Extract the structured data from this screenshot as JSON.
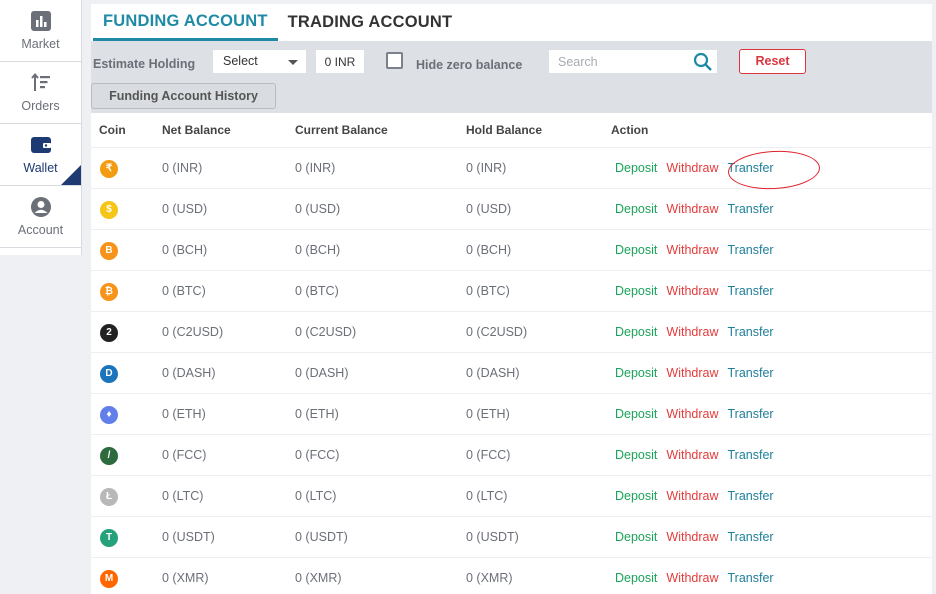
{
  "sidebar": {
    "items": [
      {
        "label": "Market",
        "icon": "chart-icon"
      },
      {
        "label": "Orders",
        "icon": "sort-icon"
      },
      {
        "label": "Wallet",
        "icon": "wallet-icon"
      },
      {
        "label": "Account",
        "icon": "user-icon"
      }
    ],
    "active": "Wallet"
  },
  "tabs": {
    "funding": "FUNDING ACCOUNT",
    "trading": "TRADING ACCOUNT"
  },
  "toolbar": {
    "estimate_label": "Estimate Holding",
    "select_value": "Select",
    "inr_value": "0 INR",
    "hide_zero_label": "Hide zero balance",
    "search_placeholder": "Search",
    "reset_label": "Reset",
    "history_label": "Funding Account History"
  },
  "table": {
    "headers": {
      "coin": "Coin",
      "net": "Net Balance",
      "current": "Current Balance",
      "hold": "Hold Balance",
      "action": "Action"
    },
    "actions": {
      "deposit": "Deposit",
      "withdraw": "Withdraw",
      "transfer": "Transfer"
    },
    "rows": [
      {
        "coin": "INR",
        "net": "0 (INR)",
        "current": "0 (INR)",
        "hold": "0 (INR)",
        "color": "#f39c12",
        "glyph": "₹"
      },
      {
        "coin": "USD",
        "net": "0 (USD)",
        "current": "0 (USD)",
        "hold": "0 (USD)",
        "color": "#f5c518",
        "glyph": "$"
      },
      {
        "coin": "BCH",
        "net": "0 (BCH)",
        "current": "0 (BCH)",
        "hold": "0 (BCH)",
        "color": "#f7931a",
        "glyph": "B"
      },
      {
        "coin": "BTC",
        "net": "0 (BTC)",
        "current": "0 (BTC)",
        "hold": "0 (BTC)",
        "color": "#f7931a",
        "glyph": "₿"
      },
      {
        "coin": "C2USD",
        "net": "0 (C2USD)",
        "current": "0 (C2USD)",
        "hold": "0 (C2USD)",
        "color": "#222222",
        "glyph": "2"
      },
      {
        "coin": "DASH",
        "net": "0 (DASH)",
        "current": "0 (DASH)",
        "hold": "0 (DASH)",
        "color": "#1c75bc",
        "glyph": "D"
      },
      {
        "coin": "ETH",
        "net": "0 (ETH)",
        "current": "0 (ETH)",
        "hold": "0 (ETH)",
        "color": "#627eea",
        "glyph": "♦"
      },
      {
        "coin": "FCC",
        "net": "0 (FCC)",
        "current": "0 (FCC)",
        "hold": "0 (FCC)",
        "color": "#2d6a3e",
        "glyph": "/"
      },
      {
        "coin": "LTC",
        "net": "0 (LTC)",
        "current": "0 (LTC)",
        "hold": "0 (LTC)",
        "color": "#b8b8b8",
        "glyph": "Ł"
      },
      {
        "coin": "USDT",
        "net": "0 (USDT)",
        "current": "0 (USDT)",
        "hold": "0 (USDT)",
        "color": "#26a17b",
        "glyph": "T"
      },
      {
        "coin": "XMR",
        "net": "0 (XMR)",
        "current": "0 (XMR)",
        "hold": "0 (XMR)",
        "color": "#ff6600",
        "glyph": "M"
      }
    ]
  },
  "colors": {
    "accent": "#1e8aa6",
    "deposit": "#1aa35a",
    "withdraw": "#e43b3b",
    "transfer": "#1e7f9a",
    "reset": "#d9363e",
    "annotation": "#e0202a"
  }
}
